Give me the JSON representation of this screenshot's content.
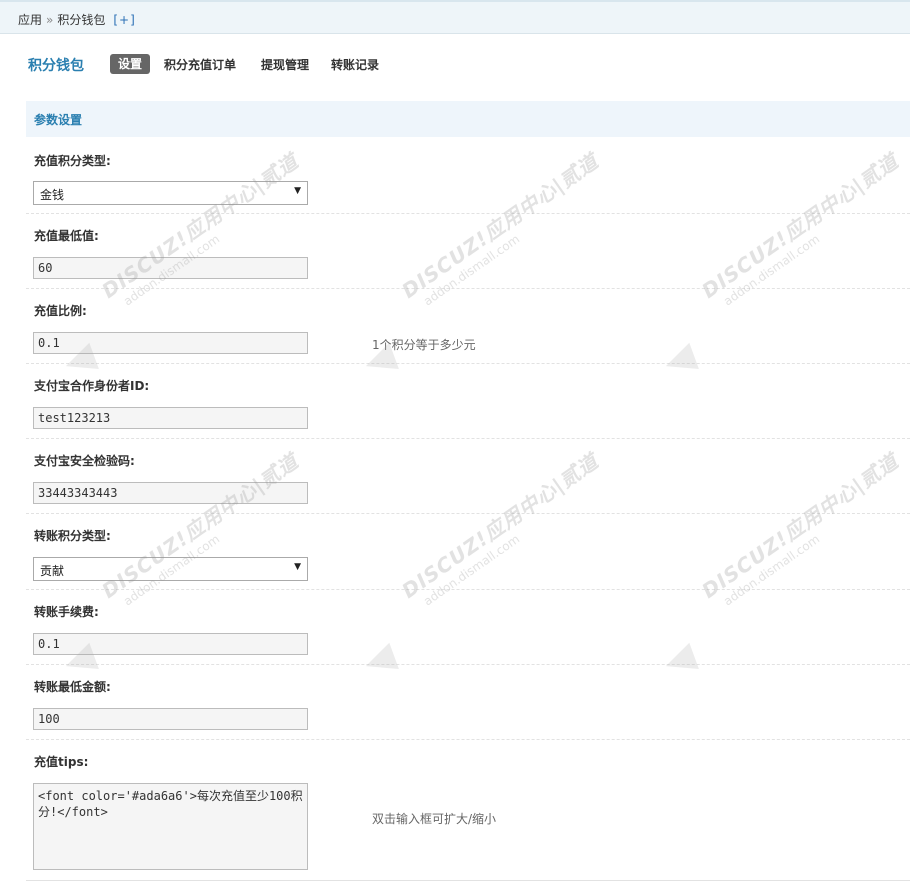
{
  "breadcrumb": {
    "root": "应用",
    "separator": "»",
    "current": "积分钱包",
    "add": "[+]"
  },
  "header": {
    "app_title": "积分钱包",
    "tabs": [
      {
        "label": "设置",
        "active": true
      },
      {
        "label": "积分充值订单",
        "active": false
      },
      {
        "label": "提现管理",
        "active": false
      },
      {
        "label": "转账记录",
        "active": false
      }
    ]
  },
  "section": {
    "title": "参数设置"
  },
  "fields": [
    {
      "label": "充值积分类型:",
      "type": "select",
      "value": "金钱"
    },
    {
      "label": "充值最低值:",
      "type": "input",
      "value": "60"
    },
    {
      "label": "充值比例:",
      "type": "input",
      "value": "0.1",
      "hint": "1个积分等于多少元"
    },
    {
      "label": "支付宝合作身份者ID:",
      "type": "input",
      "value": "test123213"
    },
    {
      "label": "支付宝安全检验码:",
      "type": "input",
      "value": "33443343443"
    },
    {
      "label": "转账积分类型:",
      "type": "select",
      "value": "贡献"
    },
    {
      "label": "转账手续费:",
      "type": "input",
      "value": "0.1"
    },
    {
      "label": "转账最低金额:",
      "type": "input",
      "value": "100"
    },
    {
      "label": "充值tips:",
      "type": "textarea",
      "value": "<font color='#ada6a6'>每次充值至少100积分!</font>",
      "hint": "双击输入框可扩大/缩小"
    }
  ],
  "select_arrow": "▼",
  "watermark": {
    "text": "DISCUZ!应用中心|贰道",
    "sub": "addon.dismall.com"
  },
  "colors": {
    "accent": "#2a7fb0",
    "tab_active_bg": "#666666",
    "section_bg": "#eef5fb"
  }
}
